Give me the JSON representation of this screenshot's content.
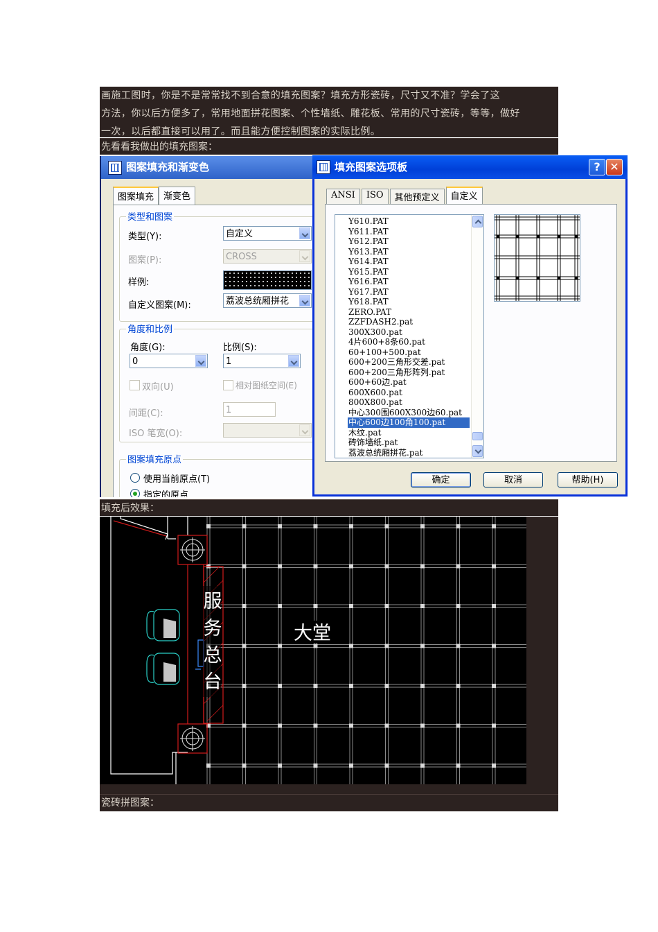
{
  "intro": {
    "line1": "画施工图时，你是不是常常找不到合意的填充图案？填充方形瓷砖，尺寸又不准？学会了这",
    "line2": "方法，你以后方便多了，常用地面拼花图案、个性墙纸、雕花板、常用的尺寸瓷砖，等等，做好",
    "line3": "一次，以后都直接可以用了。而且能方便控制图案的实际比例。"
  },
  "captions": {
    "before": "先看看我做出的填充图案：",
    "after": "填充后效果：",
    "next": "瓷砖拼图案："
  },
  "hatch_dialog": {
    "title": "图案填充和渐变色",
    "tabs": [
      "图案填充",
      "渐变色"
    ],
    "group_type": "类型和图案",
    "type_label": "类型(Y):",
    "type_value": "自定义",
    "pattern_label": "图案(P):",
    "pattern_value": "CROSS",
    "sample_label": "样例:",
    "custom_label": "自定义图案(M):",
    "custom_value": "荔波总统厢拼花",
    "group_angle": "角度和比例",
    "angle_label": "角度(G):",
    "angle_value": "0",
    "scale_label": "比例(S):",
    "scale_value": "1",
    "double_label": "双向(U)",
    "relative_label": "相对图纸空间(E)",
    "spacing_label": "间距(C):",
    "spacing_value": "1",
    "iso_label": "ISO 笔宽(O):",
    "group_origin": "图案填充原点",
    "origin_current": "使用当前原点(T)",
    "origin_specified": "指定的原点"
  },
  "palette_dialog": {
    "title": "填充图案选项板",
    "help_glyph": "?",
    "close_glyph": "✕",
    "tabs": [
      "ANSI",
      "ISO",
      "其他预定义",
      "自定义"
    ],
    "active_tab": "自定义",
    "items": [
      "Y610.PAT",
      "Y611.PAT",
      "Y612.PAT",
      "Y613.PAT",
      "Y614.PAT",
      "Y615.PAT",
      "Y616.PAT",
      "Y617.PAT",
      "Y618.PAT",
      "ZERO.PAT",
      "ZZFDASH2.pat",
      "300X300.pat",
      "4片600+8条60.pat",
      "60+100+500.pat",
      "600+200三角形交差.pat",
      "600+200三角形阵列.pat",
      "600+60边.pat",
      "600X600.pat",
      "800X800.pat",
      "中心300围600X300边60.pat",
      "中心600边100角100.pat",
      "木纹.pat",
      "砖饰墙纸.pat",
      "荔波总统厢拼花.pat"
    ],
    "selected_index": 20,
    "ok": "确定",
    "cancel": "取消",
    "help": "帮助(H)"
  },
  "cad": {
    "room_label": "大堂",
    "desk_label": [
      "服",
      "务",
      "总",
      "台"
    ]
  },
  "colors": {
    "brown_band": "#2c2220",
    "xp_blue": "#0a5ef5",
    "selection": "#316ac5",
    "cad_red": "#d11a1a"
  }
}
